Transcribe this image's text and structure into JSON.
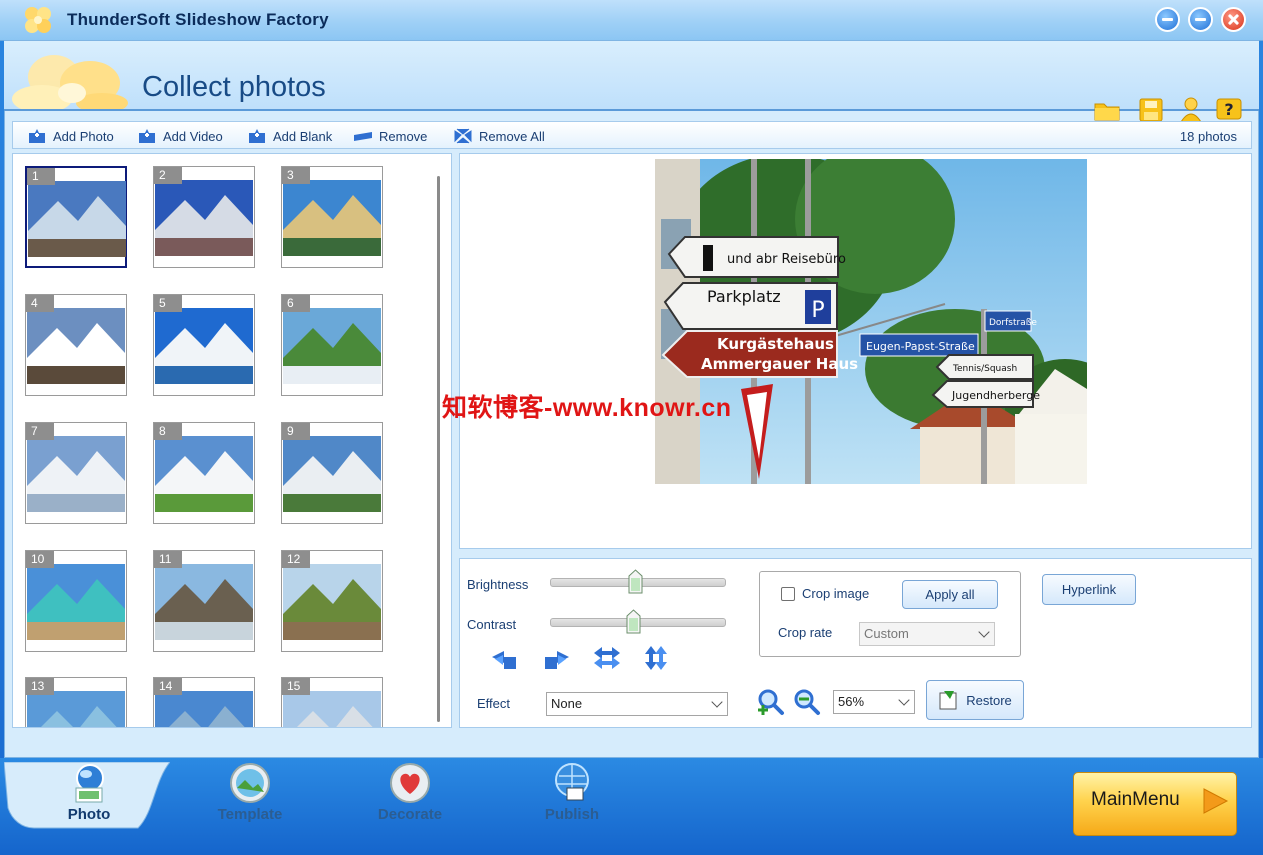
{
  "window": {
    "title": "ThunderSoft Slideshow Factory"
  },
  "header": {
    "title": "Collect photos"
  },
  "toolbar": {
    "add_photo": "Add Photo",
    "add_video": "Add Video",
    "add_blank": "Add Blank",
    "remove": "Remove",
    "remove_all": "Remove All",
    "photo_count": "18 photos"
  },
  "thumbnails": [
    "1",
    "2",
    "3",
    "4",
    "5",
    "6",
    "7",
    "8",
    "9",
    "10",
    "11",
    "12",
    "13",
    "14",
    "15"
  ],
  "selected_thumbnail": "1",
  "preview": {
    "signs": {
      "info": "und abr Reisebüro",
      "parking": "Parkplatz",
      "parking_p": "P",
      "kurgaste_1": "Kurgästehaus",
      "kurgaste_2": "Ammergauer Haus",
      "eugen": "Eugen-Papst-Straße",
      "dorf": "Dorfstraße",
      "tennis": "Tennis/Squash",
      "jugend": "Jugendherberge"
    }
  },
  "watermark": "知软博客-www.knowr.cn",
  "controls": {
    "brightness_label": "Brightness",
    "contrast_label": "Contrast",
    "brightness_value": 0.49,
    "contrast_value": 0.48,
    "effect_label": "Effect",
    "effect_value": "None",
    "crop_image_label": "Crop image",
    "apply_all_label": "Apply all",
    "crop_rate_label": "Crop rate",
    "crop_rate_value": "Custom",
    "hyperlink_label": "Hyperlink",
    "zoom_value": "56%",
    "restore_label": "Restore"
  },
  "bottom_tabs": [
    {
      "label": "Photo"
    },
    {
      "label": "Template"
    },
    {
      "label": "Decorate"
    },
    {
      "label": "Publish"
    }
  ],
  "main_menu_label": "MainMenu",
  "colors": {
    "accent": "#1b6fd6",
    "tab_active_text": "#123a6e",
    "tab_inactive_text": "#2b5d92",
    "watermark": "#e01515"
  }
}
